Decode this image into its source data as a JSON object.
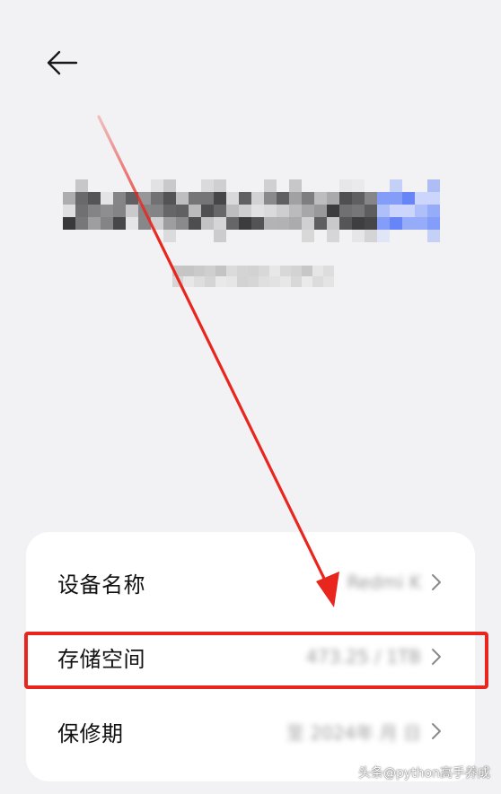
{
  "header": {
    "back_icon": "arrow-left-icon"
  },
  "brand": {
    "logo_redacted": true,
    "accent_color": "#5b7cf5"
  },
  "settings": {
    "items": [
      {
        "label": "设备名称",
        "value": "Redmi K",
        "chevron_icon": "chevron-right-icon"
      },
      {
        "label": "存储空间",
        "value": "473.25 / 1TB",
        "chevron_icon": "chevron-right-icon"
      },
      {
        "label": "保修期",
        "value": "至 2024年 月 日",
        "chevron_icon": "chevron-right-icon"
      }
    ]
  },
  "annotation": {
    "color": "#e8261e",
    "highlighted_item": "存储空间"
  },
  "watermark": {
    "text": "头条@python高手养成"
  }
}
